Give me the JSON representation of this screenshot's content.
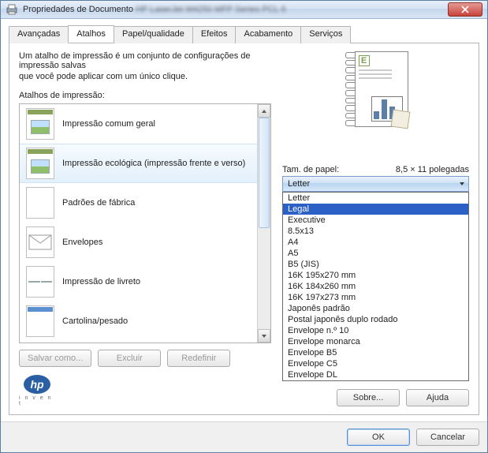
{
  "window": {
    "title": "Propriedades de Documento",
    "title_blurred": "HP LaserJet M4250 MFP Series PCL 6"
  },
  "tabs": [
    "Avançadas",
    "Atalhos",
    "Papel/qualidade",
    "Efeitos",
    "Acabamento",
    "Serviços"
  ],
  "active_tab_index": 1,
  "description_line1": "Um atalho de impressão é um conjunto de configurações de impressão salvas",
  "description_line2": "que você pode aplicar com um único clique.",
  "list_label": "Atalhos de impressão:",
  "shortcuts": [
    {
      "label": "Impressão comum geral",
      "icon": "page-e"
    },
    {
      "label": "Impressão ecológica (impressão frente e verso)",
      "icon": "page-e",
      "selected": true
    },
    {
      "label": "Padrões de fábrica",
      "icon": "page-blank"
    },
    {
      "label": "Envelopes",
      "icon": "envelope"
    },
    {
      "label": "Impressão de livreto",
      "icon": "booklet"
    },
    {
      "label": "Cartolina/pesado",
      "icon": "page-c"
    }
  ],
  "buttons": {
    "save_as": "Salvar como...",
    "delete": "Excluir",
    "reset": "Redefinir",
    "about": "Sobre...",
    "help": "Ajuda",
    "ok": "OK",
    "cancel": "Cancelar"
  },
  "paper": {
    "label": "Tam. de papel:",
    "dims": "8,5 × 11 polegadas",
    "selected": "Letter",
    "highlighted_index": 1,
    "options": [
      "Letter",
      "Legal",
      "Executive",
      "8.5x13",
      "A4",
      "A5",
      "B5 (JIS)",
      "16K 195x270 mm",
      "16K 184x260 mm",
      "16K 197x273 mm",
      "Japonês padrão",
      "Postal japonês duplo rodado",
      "Envelope n.º 10",
      "Envelope monarca",
      "Envelope B5",
      "Envelope C5",
      "Envelope DL"
    ]
  },
  "logo": {
    "text": "hp",
    "sub": "i n v e n t"
  }
}
